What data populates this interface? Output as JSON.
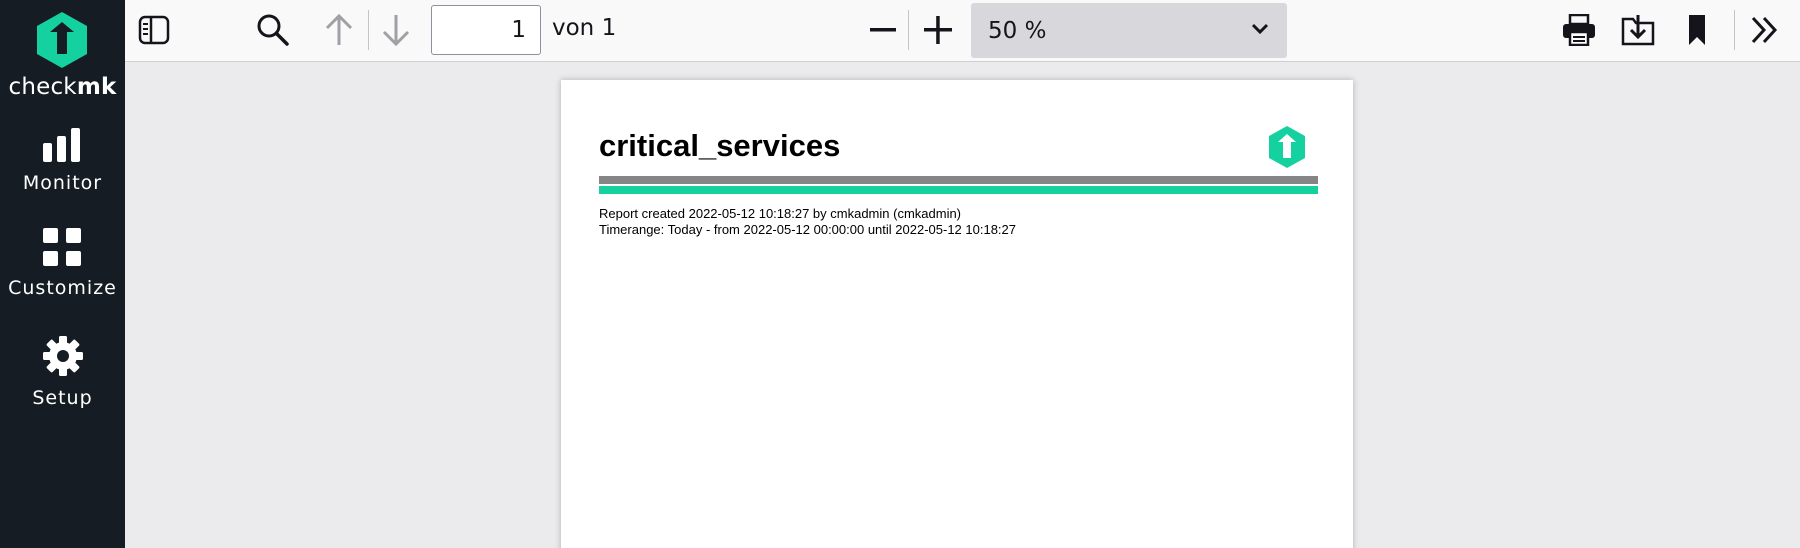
{
  "sidebar": {
    "logo": {
      "text_regular": "check",
      "text_bold": "mk",
      "color": "#15d1a0"
    },
    "items": [
      {
        "label": "Monitor",
        "icon": "bar-chart-icon"
      },
      {
        "label": "Customize",
        "icon": "grid-icon"
      },
      {
        "label": "Setup",
        "icon": "gear-icon"
      }
    ]
  },
  "toolbar": {
    "current_page": "1",
    "page_of_label": "von 1",
    "zoom_value": "50 %",
    "icons": [
      "sidebar-toggle-icon",
      "search-icon",
      "arrow-up-icon",
      "arrow-down-icon",
      "minus-icon",
      "plus-icon",
      "chevron-down-icon",
      "print-icon",
      "download-icon",
      "bookmark-icon",
      "double-chevron-right-icon"
    ]
  },
  "document": {
    "title": "critical_services",
    "meta_created": "Report created 2022-05-12 10:18:27 by cmkadmin (cmkadmin)",
    "meta_timerange": "Timerange: Today - from 2022-05-12 00:00:00 until 2022-05-12 10:18:27",
    "accent_color": "#15d1a0",
    "bar_gray_color": "#858585"
  }
}
